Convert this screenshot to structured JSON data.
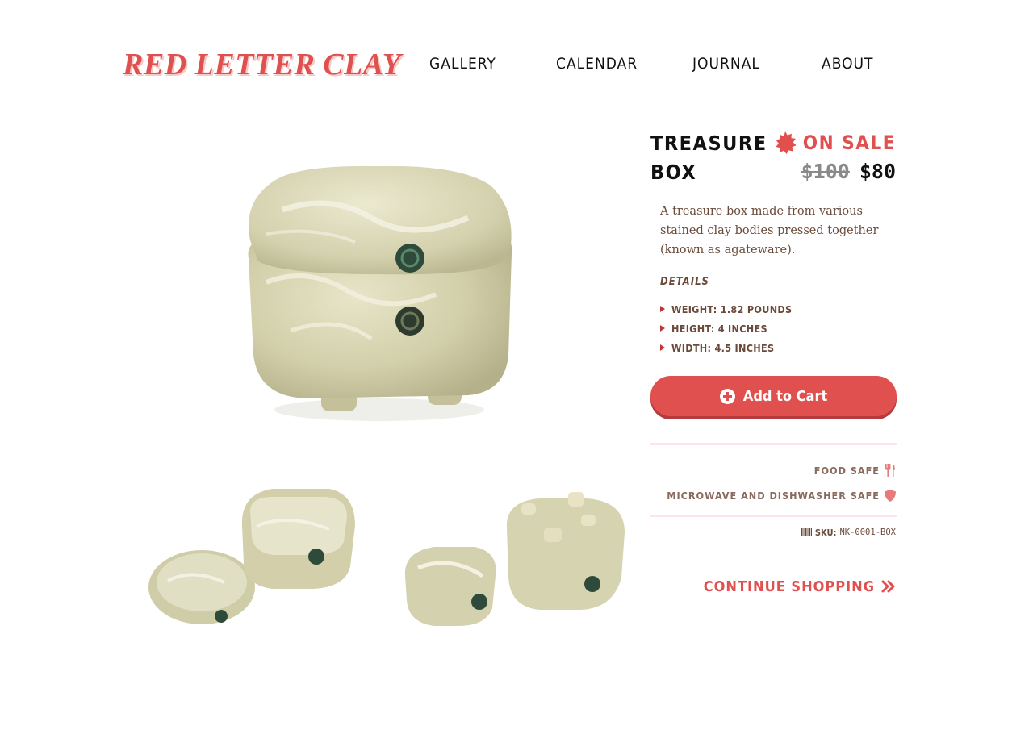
{
  "brand": {
    "logo_text": "RED LETTER CLAY"
  },
  "nav": {
    "items": [
      "GALLERY",
      "CALENDAR",
      "JOURNAL",
      "ABOUT"
    ]
  },
  "product": {
    "title": "TREASURE BOX",
    "badge": "ON SALE",
    "price_original": "$100",
    "price_sale": "$80",
    "description": "A treasure box made from various stained clay bodies pressed together (known as agateware).",
    "details_heading": "DETAILS",
    "details": [
      "WEIGHT: 1.82 POUNDS",
      "HEIGHT: 4 INCHES",
      "WIDTH: 4.5 INCHES"
    ],
    "add_to_cart_label": "Add to Cart",
    "features": [
      "FOOD SAFE",
      "MICROWAVE AND DISHWASHER SAFE"
    ],
    "sku_label": "SKU:",
    "sku_value": "NK-0001-BOX",
    "continue_label": "CONTINUE SHOPPING"
  },
  "icons": {
    "sale": "starburst-icon",
    "add": "plus-circle-icon",
    "food_safe": "fork-knife-icon",
    "dishwasher_safe": "shield-icon",
    "sku": "barcode-icon",
    "continue": "double-chevron-right-icon"
  },
  "colors": {
    "accent": "#e0504f",
    "accent_shadow": "#b53a3b",
    "body_text": "#6b4a3a",
    "divider": "#fde6ea",
    "clay": "#d6d3b0"
  }
}
